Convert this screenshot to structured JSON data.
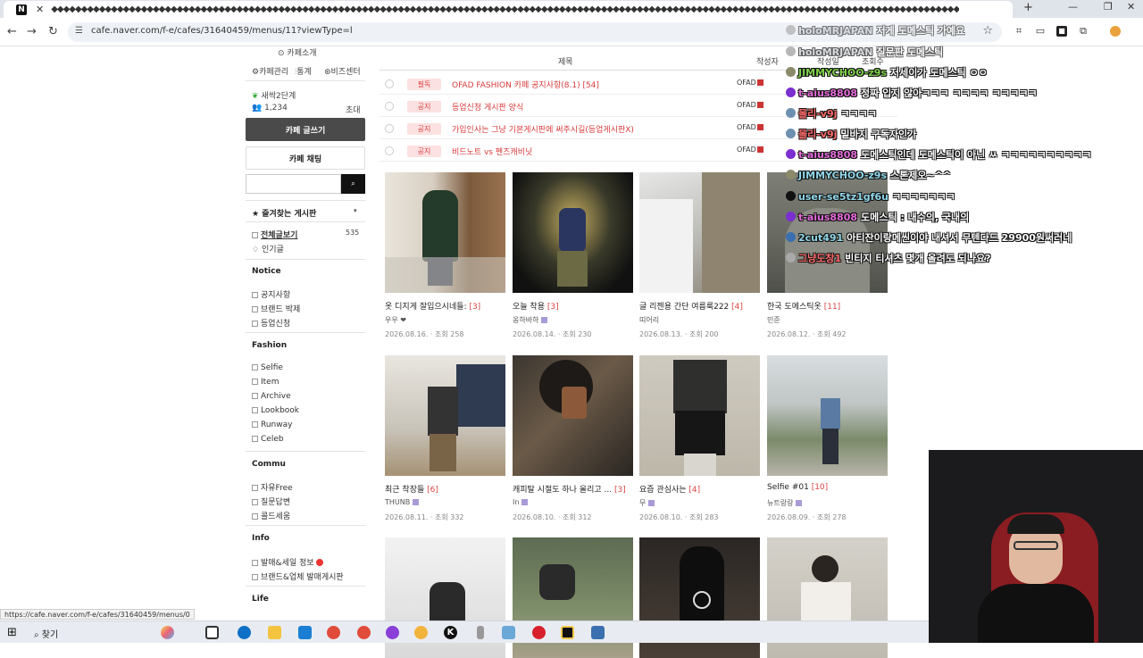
{
  "browser": {
    "tab_title": "◆◆◆◆◆◆◆◆◆◆◆◆◆◆◆◆◆◆◆◆◆◆◆◆◆◆◆◆◆◆◆◆◆◆◆◆◆◆◆◆◆◆◆◆◆◆◆◆◆◆◆◆◆◆◆◆◆◆◆◆◆◆◆◆◆◆◆◆◆◆◆◆◆◆◆◆◆◆◆◆◆◆◆◆◆◆◆◆◆◆◆◆◆◆◆◆◆◆◆◆◆◆◆◆◆◆◆◆◆◆◆◆◆◆◆◆◆◆◆◆◆◆◆◆◆◆◆◆◆◆◆◆◆◆◆◆◆◆◆◆◆◆◆◆◆◆◆◆◆◆◆◆",
    "url": "cafe.naver.com/f-e/cafes/31640459/menus/11?viewType=l",
    "status_url": "https://cafe.naver.com/f-e/cafes/31640459/menus/0"
  },
  "sidebar": {
    "cafe_intro": "카페소개",
    "cafe_manage": "카페관리",
    "stats": "통계",
    "biz_center": "비즈센터",
    "level": "새싹2단계",
    "members": "1,234",
    "invite": "초대",
    "write_button": "카페 글쓰기",
    "chat_button": "카페 채팅",
    "search_button": "검색",
    "favorites": "즐겨찾는 게시판",
    "all_posts": "전체글보기",
    "all_posts_count": "535",
    "popular": "인기글",
    "sections": [
      {
        "title": "Notice",
        "items": [
          "공지사항",
          "브랜드 박제",
          "등업신청"
        ]
      },
      {
        "title": "Fashion",
        "items": [
          "Selfie",
          "Item",
          "Archive",
          "Lookbook",
          "Runway",
          "Celeb"
        ]
      },
      {
        "title": "Commu",
        "items": [
          "자유Free",
          "질문답변",
          "콜드세움"
        ]
      },
      {
        "title": "Info",
        "items": [
          "발매&세일 정보",
          "브랜드&업체 발매게시판"
        ]
      },
      {
        "title": "Life",
        "items": []
      }
    ]
  },
  "board": {
    "col_title": "제목",
    "col_author": "작성자",
    "col_date": "작성일",
    "col_views": "조회수",
    "notices": [
      {
        "badge": "필독",
        "title": "OFAD FASHION 카페 공지사항(8.1) [54]",
        "author": "OFAD"
      },
      {
        "badge": "공지",
        "title": "등업신청 게시판 양식",
        "author": "OFAD"
      },
      {
        "badge": "공지",
        "title": "가입인사는 그냥 기본게시판에 써주시길(등업게시판X)",
        "author": "OFAD"
      },
      {
        "badge": "공지",
        "title": "비드노트 vs 펜즈캐비닛",
        "author": "OFAD"
      }
    ],
    "cards": [
      {
        "title": "옷 디지게 잘입으시네들:",
        "count": "[3]",
        "author": "우우 ❤",
        "date": "2026.08.16. · 조회 258"
      },
      {
        "title": "오늘 착용",
        "count": "[3]",
        "author": "옹하바하",
        "date": "2026.08.14. · 조회 230"
      },
      {
        "title": "글 리젠용 간단 여름룩222",
        "count": "[4]",
        "author": "띠어리",
        "date": "2026.08.13. · 조회 200"
      },
      {
        "title": "한국 도메스틱옷",
        "count": "[11]",
        "author": "민준",
        "date": "2026.08.12. · 조회 492"
      },
      {
        "title": "최근 착장들",
        "count": "[6]",
        "author": "THUNB",
        "date": "2026.08.11. · 조회 332"
      },
      {
        "title": "캐피탈 시절도 하나 올리고 ...",
        "count": "[3]",
        "author": "In",
        "date": "2026.08.10. · 조회 312"
      },
      {
        "title": "요즘 관심사는",
        "count": "[4]",
        "author": "무",
        "date": "2026.08.10. · 조회 283"
      },
      {
        "title": "Selfie #01",
        "count": "[10]",
        "author": "뉴트랑랑",
        "date": "2026.08.09. · 조회 278"
      },
      {
        "title": "",
        "count": "",
        "author": "",
        "date": ""
      },
      {
        "title": "",
        "count": "",
        "author": "",
        "date": ""
      },
      {
        "title": "",
        "count": "",
        "author": "",
        "date": ""
      },
      {
        "title": "",
        "count": "",
        "author": "",
        "date": ""
      }
    ]
  },
  "chat": [
    {
      "nick": "holoMRJAPAN",
      "msg": "저게 도메스틱 가예요",
      "color": "#bfc4cc",
      "faded": true
    },
    {
      "nick": "holoMRJAPAN",
      "msg": "질문판 도메스틱",
      "color": "#bfc4cc",
      "faded": true
    },
    {
      "nick": "JIMMYCHOO-z9s",
      "msg": "저세이가 도메스틱 ㅇㅇ",
      "color": "#7fd04a"
    },
    {
      "nick": "t-aius8808",
      "msg": "정짜 입지 않아ㅋㅋㅋ ㅋㅋㅋㅋ ㅋㅋㅋㅋㅋ",
      "color": "#e36bd9"
    },
    {
      "nick": "몰리-v9j",
      "msg": "ㅋㅋㅋㅋ",
      "color": "#ff6b6b"
    },
    {
      "nick": "몰리-v9j",
      "msg": "밑바지 구독자인가",
      "color": "#ff6b6b"
    },
    {
      "nick": "t-aius8808",
      "msg": "도메스틱인데 도메스틱이 아닌 ㅆ ㅋㅋㅋㅋㅋㅋㅋㅋㅋㅋ",
      "color": "#e36bd9"
    },
    {
      "nick": "JIMMYCHOO-z9s",
      "msg": "스톤제오~^^",
      "color": "#8fd6e8"
    },
    {
      "nick": "user-se5tz1gf6u",
      "msg": "ㅋㅋㅋㅋㅋㅋㅋ",
      "color": "#8fd6e8"
    },
    {
      "nick": "t-aius8808",
      "msg": "도메스틱 : 내수의, 국내의",
      "color": "#e36bd9"
    },
    {
      "nick": "2cut491",
      "msg": "아티잔이랑메씬이야 내셔서 무텐다드 29900원써러네",
      "color": "#8fd6e8"
    },
    {
      "nick": "그냥도창1",
      "msg": "빈티지 티셔츠 몇개 올려도 되나요?",
      "color": "#ff6b6b"
    }
  ],
  "taskbar": {
    "search_label": "찾기"
  }
}
